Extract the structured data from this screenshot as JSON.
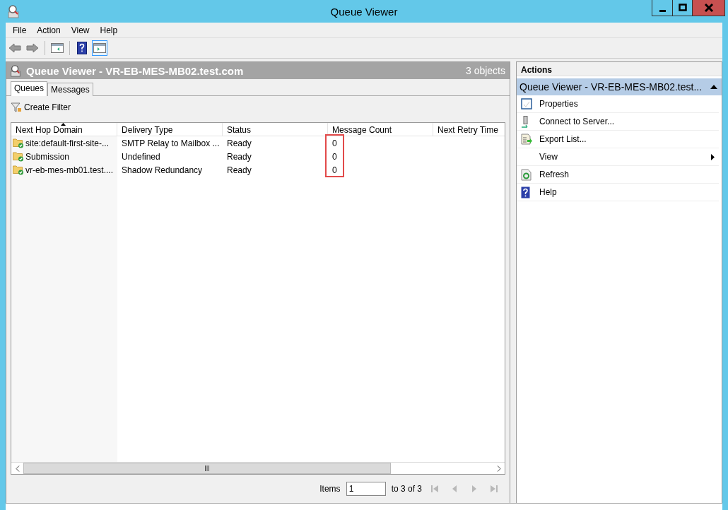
{
  "window": {
    "title": "Queue Viewer"
  },
  "menu": [
    "File",
    "Action",
    "View",
    "Help"
  ],
  "toolbar": [
    {
      "kind": "back",
      "disabled": true,
      "selected": false
    },
    {
      "kind": "forward",
      "disabled": true,
      "selected": false
    },
    {
      "kind": "tree",
      "disabled": false,
      "selected": false
    },
    {
      "kind": "help",
      "disabled": false,
      "selected": false
    },
    {
      "kind": "pane",
      "disabled": false,
      "selected": true
    }
  ],
  "main": {
    "title": "Queue Viewer - VR-EB-MES-MB02.test.com",
    "count": "3 objects",
    "tabs": [
      {
        "label": "Queues",
        "selected": true
      },
      {
        "label": "Messages",
        "selected": false
      }
    ],
    "filter_button": "Create Filter",
    "table": {
      "columns": [
        {
          "label": "Next Hop Domain",
          "sorted": true,
          "highlighted": false
        },
        {
          "label": "Delivery Type",
          "sorted": false,
          "highlighted": false
        },
        {
          "label": "Status",
          "sorted": false,
          "highlighted": false
        },
        {
          "label": "Message Count",
          "sorted": false,
          "highlighted": true
        },
        {
          "label": "Next Retry Time",
          "sorted": false,
          "highlighted": false
        }
      ],
      "rows": [
        [
          "site:default-first-site-...",
          "SMTP Relay to Mailbox ...",
          "Ready",
          "0"
        ],
        [
          "Submission",
          "Undefined",
          "Ready",
          "0"
        ],
        [
          "vr-eb-mes-mb01.test....",
          "Shadow Redundancy",
          "Ready",
          "0"
        ]
      ]
    },
    "paging": {
      "label": "Items",
      "value": "1",
      "range": "to 3 of 3",
      "buttons": [
        {
          "kind": "first",
          "disabled": true
        },
        {
          "kind": "prev",
          "disabled": true
        },
        {
          "kind": "next",
          "disabled": true
        },
        {
          "kind": "last",
          "disabled": true
        }
      ]
    }
  },
  "actions": {
    "title": "Actions",
    "section": {
      "title": "Queue Viewer - VR-EB-MES-MB02.test...",
      "expanded": true
    },
    "items": [
      {
        "label": "Properties",
        "kind": "properties",
        "submenu": false
      },
      {
        "label": "Connect to Server...",
        "kind": "server",
        "submenu": false
      },
      {
        "label": "Export List...",
        "kind": "export",
        "submenu": false
      },
      {
        "label": "View",
        "kind": "submenu",
        "submenu": true
      },
      {
        "label": "Refresh",
        "kind": "refresh",
        "submenu": false
      },
      {
        "label": "Help",
        "kind": "help",
        "submenu": false
      }
    ]
  }
}
